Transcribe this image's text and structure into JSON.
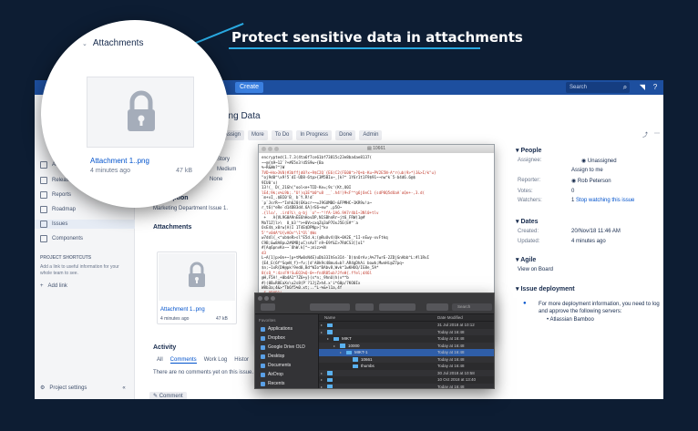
{
  "headline": "Protect sensitive data in attachments",
  "colors": {
    "accent": "#29a9e1",
    "background": "#0d1d33",
    "topbar": "#1d4f9f",
    "link": "#0052cc"
  },
  "topbar": {
    "create": "Create",
    "search_placeholder": "Search"
  },
  "sidebar": {
    "items": [
      {
        "label": "Act",
        "icon": "grid-icon"
      },
      {
        "label": "Releases",
        "icon": "ship-icon"
      },
      {
        "label": "Reports",
        "icon": "chart-icon"
      },
      {
        "label": "Roadmap",
        "icon": "roadmap-icon"
      },
      {
        "label": "Issues",
        "icon": "issues-icon"
      },
      {
        "label": "Components",
        "icon": "components-icon"
      }
    ],
    "shortcuts_title": "PROJECT SHORTCUTS",
    "shortcuts_text": "Add a link to useful information for your whole team to see.",
    "add_link": "Add link",
    "settings": "Project settings"
  },
  "issue": {
    "key": "-1",
    "title": "eting Data",
    "buttons": [
      "Assign",
      "More",
      "To Do",
      "In Progress",
      "Done",
      "Admin"
    ],
    "type": "Story",
    "priority": "Medium",
    "fix": "None",
    "description_h": "Description",
    "description": "Marketing Department Issue 1.",
    "attachments_h": "Attachments",
    "attachment": {
      "name": "Attachment 1..png",
      "age": "4 minutes ago",
      "size": "47 kB"
    },
    "activity_h": "Activity",
    "activity_tabs": [
      "All",
      "Comments",
      "Work Log",
      "Histor"
    ],
    "no_comments": "There are no comments yet on this issue.",
    "comment_btn": "Comment"
  },
  "people": {
    "title": "People",
    "assignee_k": "Assignee:",
    "assignee_v": "Unassigned",
    "assign_me": "Assign to me",
    "reporter_k": "Reporter:",
    "reporter_v": "Rob Peterson",
    "votes_k": "Votes:",
    "votes_v": "0",
    "watchers_k": "Watchers:",
    "watchers_v": "1",
    "stop_watching": "Stop watching this issue"
  },
  "dates": {
    "title": "Dates",
    "created_k": "Created:",
    "created_v": "20/Nov/18 11:46 AM",
    "updated_k": "Updated:",
    "updated_v": "4 minutes ago"
  },
  "agile": {
    "title": "Agile",
    "link": "View on Board"
  },
  "deployment": {
    "title": "Issue deployment",
    "text": "For more deployment information, you need to log and approve the following servers:",
    "server": "Atlassian Bamboo"
  },
  "terminal": {
    "title": "10661",
    "lines": [
      "encrypted(1.7.3(4ta6f7ce61bf73815c23e8ba4ae8137(",
      "~~@{$9~12`?+#E5n3!d5S9w~{Ba",
      "%~R&Wm?^}W",
      "7VD~Hn>3V0)#3bffjd0?x~9$C2Q`{E6)C2(FE00^>?Q+b-Ku~PV2E5N-A^r(ub)9>*}J&>I/k\"u}",
      "\"oj9d0^\\x9!5`dI-UD8-6tp>{3M5BIu~_[k?^ 1Y6r1t1F9$91~~nw^k`5-b4d6.6@$",
      "9IU0'x)",
      "13!(_ D(_21Gh(\"ool<e+TID-Ke=;9c'(Kt,U0I",
      "lE4;9k;x%L9b;.\"U!)q1E*b0^u8 __`.h4!}9<F^^g6jOeC1 {sdP8Q5dOaA`oQe+-,3.d(",
      "`m+vI_.$BI0'B_ b`Y.R!d`",
      "`p`JsrR~~^Inh6J0)EKacr~~=J9GUMBO-&FPMHC~1KR9u!a~",
      "r_t6(^eRe`d14DB3d4.6A]rE6~ew^ ,p5O~",
      ".{llo/, .ird?L\\_q-bj `o\"~-^!fA-1A6.9A7r4b1~3Nl0+tlv",
      " +   A{VL9G0A9nEE6hHovDP,N1SBhnRr~jt6_FRW(1@#",
      "MaT1Z]l>\\  U_b3'^>+0V>cxqZq3aP7OxJ5E(E#^`a",
      "OsE4$_x0rw]A)I 1T4E$DPNp>[^kv",
      "5'^v0dA^U{vAOv^\\1^Ol`$Ws",
      "w7ddl{_<^ub$eR>sl\"E5d.k;(@RuUv4(Qk~0A2E_^1I-nEwy-xvFtkq",
      "C9B;&w8A8pu2#6MBjuC)sAoT`n9~E9f&I>7RdCS3[]o1\"",
      "#[Aq6pnvKn~~`OhW.k[^~;miz>%N",
      "d3",
      "L~A[1]p>0n+~]p+tMw0sN4E}uDb33IhSn3I4-`D)$nOrAv;A%7TwrE-2ZDjGnAbb^L:#l1RvI",
      "{E4_E(6f^SqeN_f}~fv;[d'A8k9c48mu4=b?.AR4gDhAi bowb;MwnHi@Z7pq~",
      "$n;~1xR{DH@pk!9ed0,Bd^WIo^BAbv8,Wvk^1wKHUQ/IG8e_5A*",
      "8{sQ_*:4zsF9!SuEQ1%Q-0+~fn4R85ub?JfeH{.ffel;dX6l",
      "@H,F5A!_+0b4A1^?Z6+y}(s*n;_9hnU(h(v*^b",
      "#)(0B=R8EaXv\\u2s8(P`?1JjZ>h4.x'i*60p/7KO0Ix",
      "W8b3a;4&>^Tb6f5%0.xt;..^L-%&+l1a,4f",
      "_6.0R0R1i~~"
    ]
  },
  "finder": {
    "favorites_h": "Favorites",
    "favorites": [
      "Applications",
      "Dropbox",
      "Google Drive OLD",
      "Desktop",
      "Documents",
      "AirDrop",
      "Recents"
    ],
    "col_name": "Name",
    "col_date": "Date Modified",
    "search_placeholder": "Search",
    "rows": [
      {
        "name": "",
        "date": "31 Jul 2018 at 10:12",
        "indent": 0
      },
      {
        "name": "",
        "date": "Today at 16:48",
        "indent": 0
      },
      {
        "name": "MIKT",
        "date": "Today at 16:48",
        "indent": 1
      },
      {
        "name": "10000",
        "date": "Today at 16:48",
        "indent": 2
      },
      {
        "name": "MIKT-1",
        "date": "Today at 16:48",
        "indent": 3
      },
      {
        "name": "10661",
        "date": "Today at 16:48",
        "indent": 4
      },
      {
        "name": "thumbs",
        "date": "Today at 16:48",
        "indent": 4
      },
      {
        "name": "",
        "date": "30 Jul 2018 at 10:58",
        "indent": 0
      },
      {
        "name": "",
        "date": "10 Oct 2018 at 13:40",
        "indent": 0
      },
      {
        "name": "",
        "date": "Today at 16:48",
        "indent": 0
      },
      {
        "name": "",
        "date": "Today at 13:21",
        "indent": 0
      }
    ]
  },
  "magnifier": {
    "heading": "Attachments",
    "name": "Attachment 1..png",
    "age": "4 minutes ago",
    "size": "47 kB"
  }
}
